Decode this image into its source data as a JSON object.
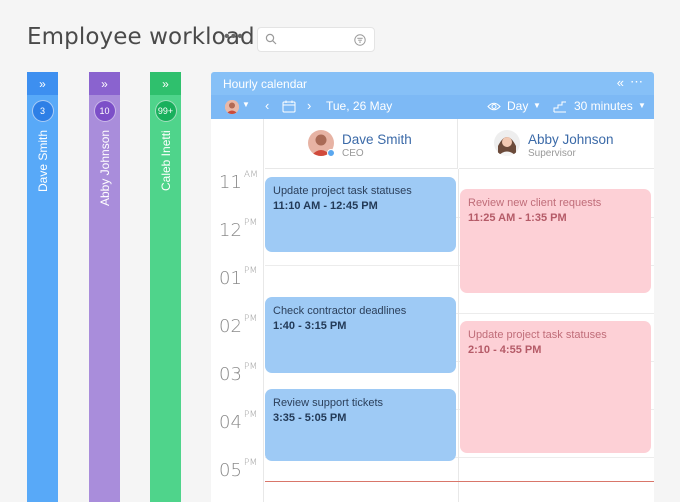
{
  "header": {
    "title": "Employee workload",
    "more_label": "•••",
    "search_placeholder": ""
  },
  "employees": [
    {
      "name": "Dave Smith",
      "count": "3",
      "color": "#58a9f8"
    },
    {
      "name": "Abby Johnson",
      "count": "10",
      "color": "#a98ddb"
    },
    {
      "name": "Caleb Inetti",
      "count": "99+",
      "color": "#4fd48b"
    }
  ],
  "calendar": {
    "title": "Hourly calendar",
    "date": "Tue, 26 May",
    "view": "Day",
    "interval": "30 minutes",
    "resources": [
      {
        "name": "Dave Smith",
        "role": "CEO"
      },
      {
        "name": "Abby Johnson",
        "role": "Supervisor"
      }
    ],
    "hours": [
      {
        "h": "11",
        "p": "AM"
      },
      {
        "h": "12",
        "p": "PM"
      },
      {
        "h": "01",
        "p": "PM"
      },
      {
        "h": "02",
        "p": "PM"
      },
      {
        "h": "03",
        "p": "PM"
      },
      {
        "h": "04",
        "p": "PM"
      },
      {
        "h": "05",
        "p": "PM"
      }
    ],
    "events": [
      {
        "resource": 0,
        "title": "Update project task statuses",
        "time": "11:10 AM - 12:45 PM",
        "color": "#9ecaf5"
      },
      {
        "resource": 0,
        "title": "Check contractor deadlines",
        "time": "1:40 - 3:15 PM",
        "color": "#9ecaf5"
      },
      {
        "resource": 0,
        "title": "Review support tickets",
        "time": "3:35 - 5:05 PM",
        "color": "#9ecaf5"
      },
      {
        "resource": 1,
        "title": "Review new client requests",
        "time": "11:25 AM - 1:35 PM",
        "color": "#fdd0d6"
      },
      {
        "resource": 1,
        "title": "Update project task statuses",
        "time": "2:10 - 4:55 PM",
        "color": "#fdd0d6"
      }
    ]
  }
}
